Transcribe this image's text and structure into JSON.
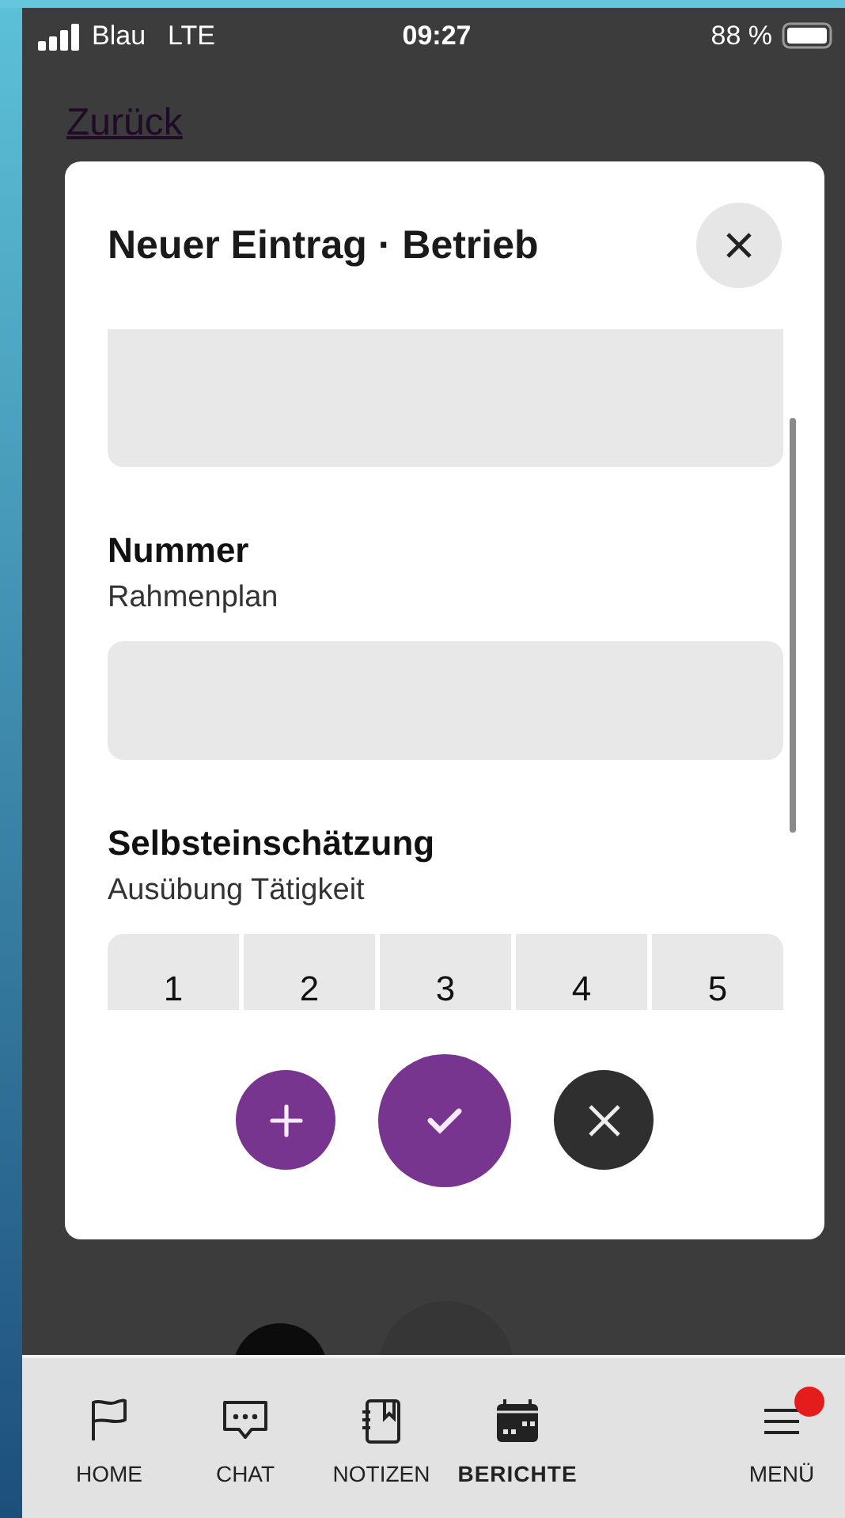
{
  "status_bar": {
    "carrier": "Blau",
    "network": "LTE",
    "time": "09:27",
    "battery": "88 %"
  },
  "back_link": "Zurück",
  "dialog": {
    "title": "Neuer Eintrag · Betrieb",
    "sections": [
      {
        "kind": "text",
        "label": "Nummer",
        "sublabel": "Rahmenplan"
      },
      {
        "kind": "rating",
        "label": "Selbsteinschätzung",
        "sublabel": "Ausübung Tätigkeit",
        "options": [
          "1",
          "2",
          "3",
          "4",
          "5"
        ]
      }
    ]
  },
  "tabs": [
    {
      "label": "HOME",
      "selected": false,
      "badge": false
    },
    {
      "label": "CHAT",
      "selected": false,
      "badge": false
    },
    {
      "label": "NOTIZEN",
      "selected": false,
      "badge": false
    },
    {
      "label": "BERICHTE",
      "selected": true,
      "badge": false
    },
    {
      "label": "MENÜ",
      "selected": false,
      "badge": true
    }
  ]
}
